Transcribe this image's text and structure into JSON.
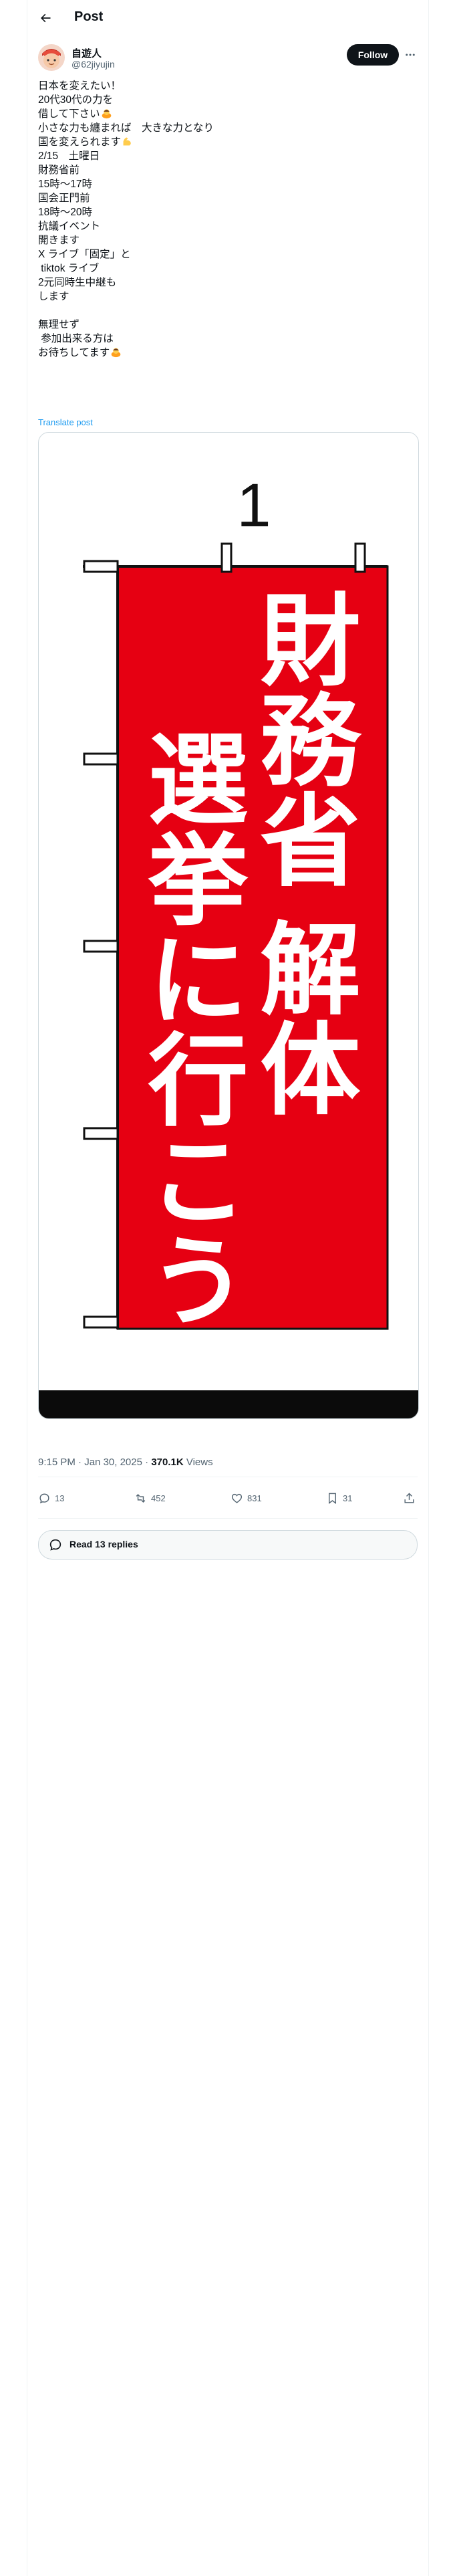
{
  "header": {
    "title": "Post"
  },
  "author": {
    "name": "自遊人",
    "handle": "@62jiyujin"
  },
  "follow_label": "Follow",
  "tweet_lines": [
    "日本を変えたい！",
    "20代30代の力を",
    "借して下さい",
    "小さな力も纏まれば　大きな力となり",
    "国を変えられます",
    "2/15　土曜日",
    "財務省前",
    "15時〜17時",
    "国会正門前",
    "18時〜20時",
    "抗議イベント",
    "開きます",
    "X ライブ「固定」と",
    " tiktok ライブ",
    "2元同時生中継も",
    "します",
    "",
    "無理せず",
    " 参加出来る方は",
    "お待ちしてます"
  ],
  "emoji_names": [
    "bowing-person-emoji",
    "flexed-biceps-emoji",
    "bowing-person-emoji"
  ],
  "translate_label": "Translate post",
  "image": {
    "flag_number": "1",
    "flag_text_right": "財務省 解体",
    "flag_text_left": "選挙に行こう",
    "flag_color": "#e60012",
    "flag_text_color": "#ffffff"
  },
  "meta": {
    "time": "9:15 PM",
    "date": "Jan 30, 2025",
    "views_count": "370.1K",
    "views_label": "Views"
  },
  "stats": {
    "replies": "13",
    "reposts": "452",
    "likes": "831",
    "bookmarks": "31"
  },
  "read_replies_label": "Read 13 replies",
  "colors": {
    "accent": "#1d9bf0",
    "text": "#0f1419",
    "muted": "#536471",
    "border": "#eff3f4"
  }
}
